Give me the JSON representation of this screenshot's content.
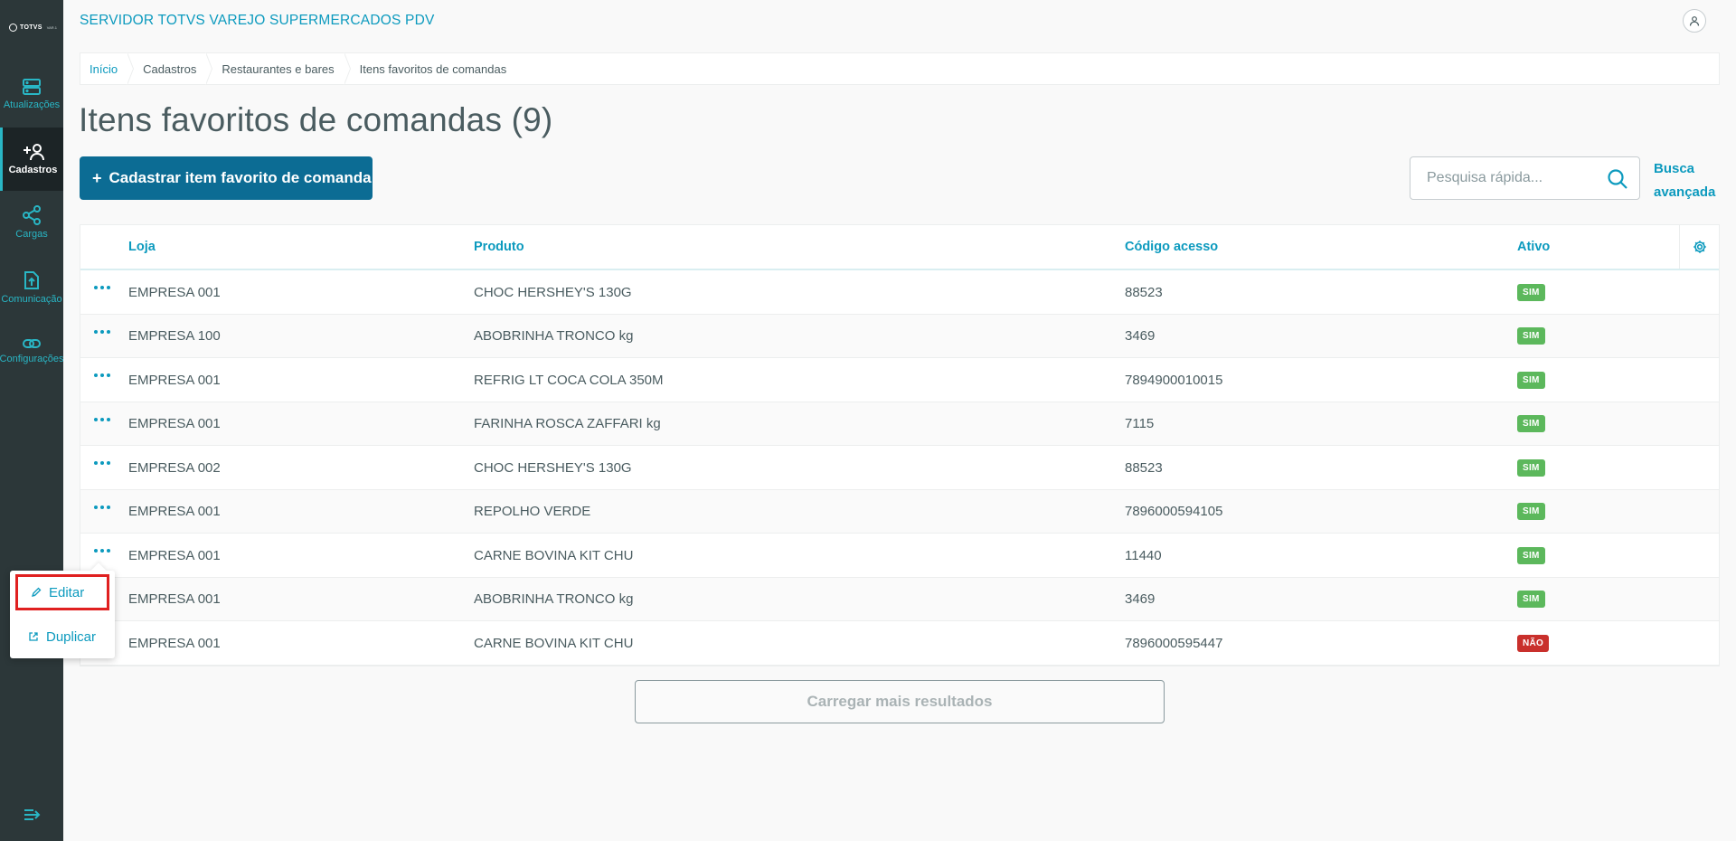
{
  "sidebar": {
    "logo": {
      "text": "TOTVS",
      "sub": "VAR.1"
    },
    "items": [
      {
        "label": "Atualizações",
        "icon": "server-icon"
      },
      {
        "label": "Cadastros",
        "icon": "add-user-icon",
        "active": true
      },
      {
        "label": "Cargas",
        "icon": "share-icon"
      },
      {
        "label": "Comunicação",
        "icon": "upload-file-icon"
      },
      {
        "label": "Configurações",
        "icon": "link-icon"
      }
    ]
  },
  "header": {
    "title": "SERVIDOR TOTVS VAREJO SUPERMERCADOS PDV"
  },
  "breadcrumb": [
    "Início",
    "Cadastros",
    "Restaurantes e bares",
    "Itens favoritos de comandas"
  ],
  "page": {
    "title": "Itens favoritos de comandas (9)",
    "add_button_label": "Cadastrar item favorito de comanda",
    "search_placeholder": "Pesquisa rápida...",
    "advanced_search_label": "Busca avançada"
  },
  "table": {
    "columns": [
      "Loja",
      "Produto",
      "Código acesso",
      "Ativo"
    ],
    "rows": [
      {
        "loja": "EMPRESA 001",
        "produto": "CHOC HERSHEY'S 130G",
        "codigo": "88523",
        "ativo": "SIM"
      },
      {
        "loja": "EMPRESA 100",
        "produto": "ABOBRINHA TRONCO kg",
        "codigo": "3469",
        "ativo": "SIM"
      },
      {
        "loja": "EMPRESA 001",
        "produto": "REFRIG LT COCA COLA 350M",
        "codigo": "7894900010015",
        "ativo": "SIM"
      },
      {
        "loja": "EMPRESA 001",
        "produto": "FARINHA ROSCA ZAFFARI kg",
        "codigo": "7115",
        "ativo": "SIM"
      },
      {
        "loja": "EMPRESA 002",
        "produto": "CHOC HERSHEY'S 130G",
        "codigo": "88523",
        "ativo": "SIM"
      },
      {
        "loja": "EMPRESA 001",
        "produto": "REPOLHO VERDE",
        "codigo": "7896000594105",
        "ativo": "SIM"
      },
      {
        "loja": "EMPRESA 001",
        "produto": "CARNE BOVINA KIT CHU",
        "codigo": "11440",
        "ativo": "SIM"
      },
      {
        "loja": "EMPRESA 001",
        "produto": "ABOBRINHA TRONCO kg",
        "codigo": "3469",
        "ativo": "SIM"
      },
      {
        "loja": "EMPRESA 001",
        "produto": "CARNE BOVINA KIT CHU",
        "codigo": "7896000595447",
        "ativo": "NÃO"
      }
    ]
  },
  "load_more_label": "Carregar mais resultados",
  "context_menu": {
    "items": [
      {
        "label": "Editar",
        "icon": "pencil-icon",
        "highlighted": true
      },
      {
        "label": "Duplicar",
        "icon": "external-link-icon"
      }
    ]
  },
  "colors": {
    "sidebar_bg": "#2c3739",
    "accent": "#0c9abe",
    "primary_button": "#0c6c94",
    "badge_yes": "#5cb85c",
    "badge_no": "#c9302c",
    "highlight": "#e02020"
  }
}
